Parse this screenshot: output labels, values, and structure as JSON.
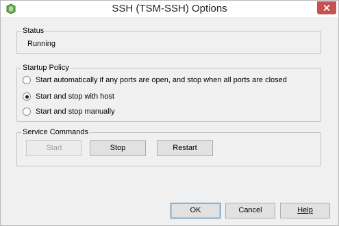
{
  "window": {
    "title": "SSH (TSM-SSH) Options",
    "icon": "vsphere-client-icon",
    "close_icon": "close-icon"
  },
  "status": {
    "group_label": "Status",
    "value": "Running"
  },
  "startup_policy": {
    "group_label": "Startup Policy",
    "options": [
      {
        "label": "Start automatically if any ports are open, and stop when all ports are closed",
        "selected": false
      },
      {
        "label": "Start and stop with host",
        "selected": true
      },
      {
        "label": "Start and stop manually",
        "selected": false
      }
    ]
  },
  "service_commands": {
    "group_label": "Service Commands",
    "start_label": "Start",
    "stop_label": "Stop",
    "restart_label": "Restart",
    "start_enabled": false
  },
  "footer": {
    "ok_label": "OK",
    "cancel_label": "Cancel",
    "help_label": "Help"
  },
  "colors": {
    "close_button": "#c75050",
    "dialog_background": "#f0f0f0",
    "default_button_border": "#3c7fb1"
  }
}
